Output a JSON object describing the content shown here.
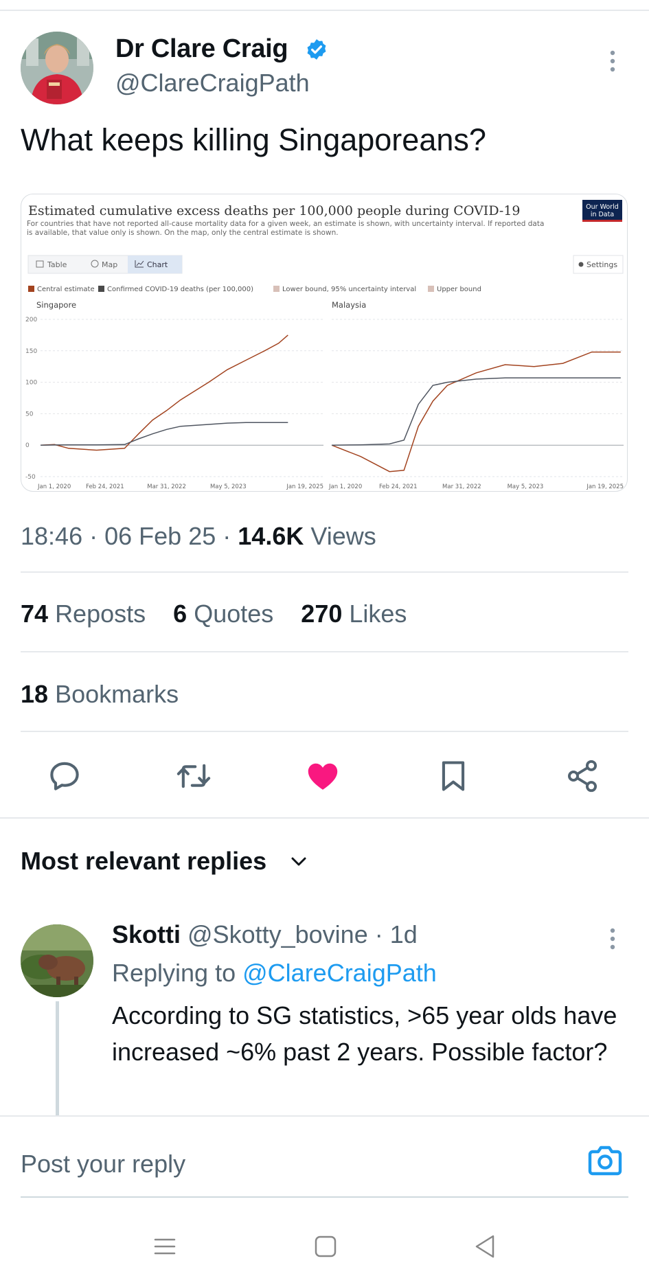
{
  "tweet": {
    "author_name": "Dr Clare Craig",
    "handle": "@ClareCraigPath",
    "text": "What keeps killing Singaporeans?",
    "time": "18:46",
    "date": "06 Feb 25",
    "views_count": "14.6K",
    "views_label": "Views"
  },
  "stats": {
    "reposts": "74",
    "reposts_label": "Reposts",
    "quotes": "6",
    "quotes_label": "Quotes",
    "likes": "270",
    "likes_label": "Likes",
    "bookmarks": "18",
    "bookmarks_label": "Bookmarks"
  },
  "actions": {
    "icons": [
      "reply-icon",
      "repost-icon",
      "like-icon",
      "bookmark-icon",
      "share-icon"
    ],
    "like_color": "#f91880",
    "icon_color": "#536471"
  },
  "replies_section": {
    "title": "Most relevant replies"
  },
  "reply": {
    "name": "Skotti",
    "handle": "@Skotty_bovine",
    "age": "1d",
    "replying_prefix": "Replying to",
    "replying_to": "@ClareCraigPath",
    "text": "According to SG statistics, >65 year olds have increased ~6% past 2 years. Possible factor?"
  },
  "composer": {
    "placeholder": "Post your reply"
  },
  "colors": {
    "accent": "#1d9bf0",
    "secondary_text": "#536471"
  },
  "chart_data": {
    "type": "line",
    "title": "Estimated cumulative excess deaths per 100,000 people during COVID-19",
    "subtitle": "For countries that have not reported all-cause mortality data for a given week, an estimate is shown, with uncertainty interval. If reported data is available, that value only is shown. On the map, only the central estimate is shown.",
    "logo": "Our World in Data",
    "tabs": [
      "Table",
      "Map",
      "Chart"
    ],
    "active_tab": "Chart",
    "settings_label": "Settings",
    "legend": [
      {
        "name": "Central estimate",
        "color": "#a2431f"
      },
      {
        "name": "Confirmed COVID-19 deaths (per 100,000)",
        "color": "#4a4a4a"
      },
      {
        "name": "Lower bound, 95% uncertainty interval",
        "color": "#d8c0b8"
      },
      {
        "name": "Upper bound",
        "color": "#d8c0b8"
      }
    ],
    "ylim": [
      -50,
      200
    ],
    "yticks": [
      "200",
      "150",
      "100",
      "50",
      "0",
      "-50"
    ],
    "xticks": [
      "Jan 1, 2020",
      "Feb 24, 2021",
      "Mar 31, 2022",
      "May 5, 2023",
      "Jan 19, 2025"
    ],
    "panels": [
      {
        "name": "Singapore",
        "x": [
          "2020-01",
          "2020-04",
          "2020-07",
          "2021-01",
          "2021-07",
          "2021-10",
          "2022-01",
          "2022-04",
          "2022-07",
          "2023-01",
          "2023-05",
          "2023-09",
          "2024-01",
          "2024-04",
          "2024-06"
        ],
        "series": [
          {
            "name": "Central estimate",
            "values": [
              0,
              1,
              -5,
              -8,
              -5,
              18,
              40,
              55,
              72,
              100,
              120,
              135,
              150,
              162,
              175
            ]
          },
          {
            "name": "Confirmed COVID-19 deaths (per 100,000)",
            "values": [
              0,
              0.3,
              0.5,
              0.5,
              1,
              10,
              18,
              25,
              30,
              33,
              35,
              36,
              36,
              36,
              36
            ]
          }
        ]
      },
      {
        "name": "Malaysia",
        "x": [
          "2020-01",
          "2020-07",
          "2021-01",
          "2021-04",
          "2021-07",
          "2021-10",
          "2022-01",
          "2022-07",
          "2023-01",
          "2023-07",
          "2024-01",
          "2024-07",
          "2025-01"
        ],
        "series": [
          {
            "name": "Central estimate",
            "values": [
              0,
              -18,
              -42,
              -40,
              30,
              70,
              95,
              115,
              128,
              125,
              130,
              148,
              148
            ]
          },
          {
            "name": "Confirmed COVID-19 deaths (per 100,000)",
            "values": [
              0,
              0.5,
              2,
              8,
              65,
              95,
              100,
              105,
              107,
              107,
              107,
              107,
              107
            ]
          }
        ]
      }
    ]
  }
}
